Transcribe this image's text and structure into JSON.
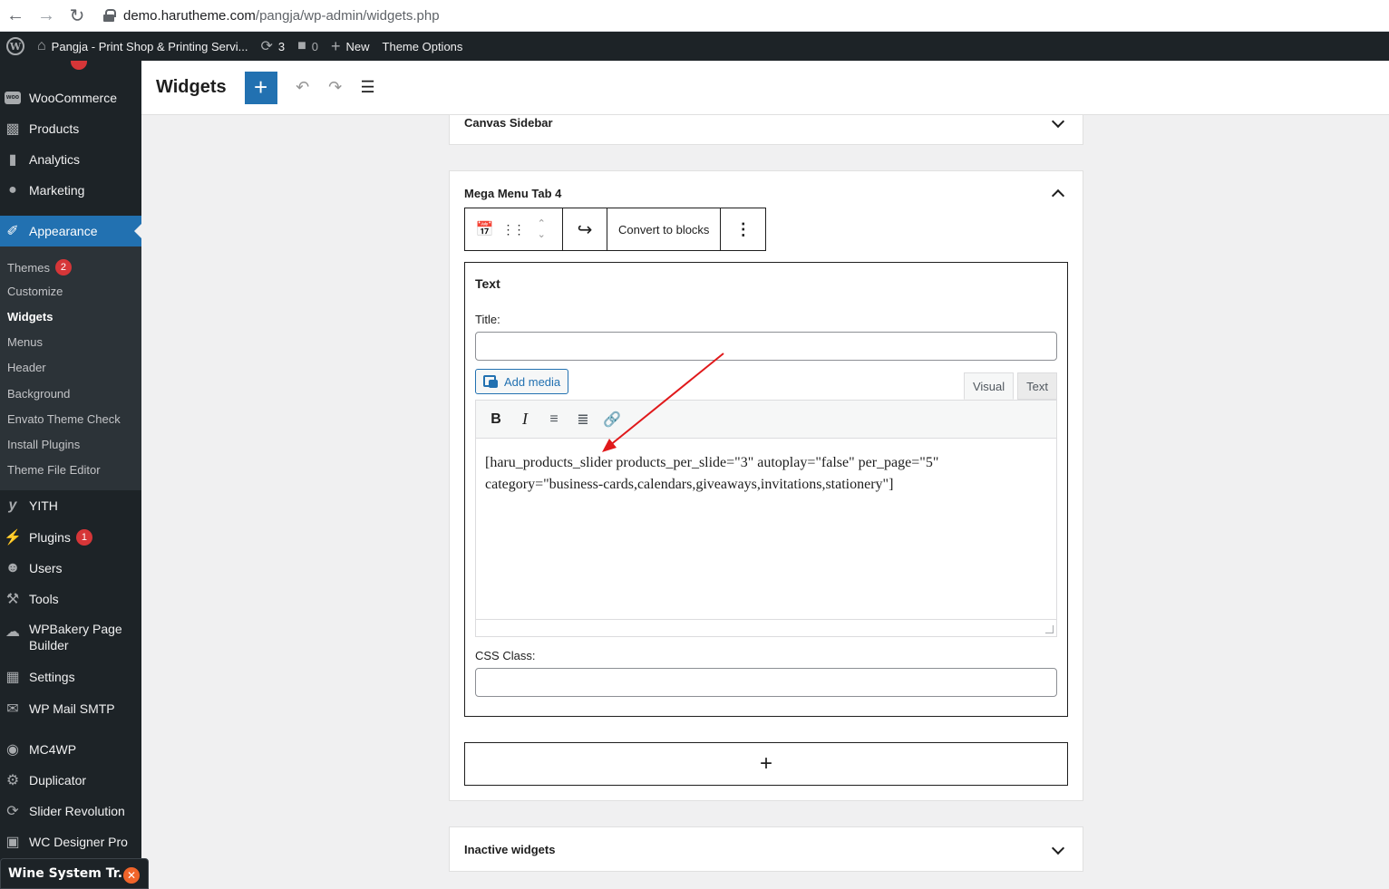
{
  "browser": {
    "url_host": "demo.harutheme.com",
    "url_path": "/pangja/wp-admin/widgets.php"
  },
  "adminbar": {
    "site_name": "Pangja - Print Shop & Printing Servi...",
    "updates_count": "3",
    "comments_count": "0",
    "new_label": "New",
    "theme_options_label": "Theme Options"
  },
  "sidebar": {
    "items": [
      {
        "label": "WooCommerce",
        "icon": "woocommerce-icon"
      },
      {
        "label": "Products",
        "icon": "products-icon"
      },
      {
        "label": "Analytics",
        "icon": "analytics-icon"
      },
      {
        "label": "Marketing",
        "icon": "marketing-icon"
      },
      {
        "label": "Appearance",
        "icon": "appearance-icon"
      },
      {
        "label": "YITH",
        "icon": "yith-icon"
      },
      {
        "label": "Plugins",
        "icon": "plugins-icon",
        "badge": "1"
      },
      {
        "label": "Users",
        "icon": "users-icon"
      },
      {
        "label": "Tools",
        "icon": "tools-icon"
      },
      {
        "label": "WPBakery Page Builder",
        "icon": "wpbakery-icon"
      },
      {
        "label": "Settings",
        "icon": "settings-icon"
      },
      {
        "label": "WP Mail SMTP",
        "icon": "mail-icon"
      },
      {
        "label": "MC4WP",
        "icon": "mc4wp-icon"
      },
      {
        "label": "Duplicator",
        "icon": "duplicator-icon"
      },
      {
        "label": "Slider Revolution",
        "icon": "slider-icon"
      },
      {
        "label": "WC Designer Pro",
        "icon": "designer-icon"
      }
    ],
    "submenu": [
      {
        "label": "Themes",
        "badge": "2"
      },
      {
        "label": "Customize"
      },
      {
        "label": "Widgets"
      },
      {
        "label": "Menus"
      },
      {
        "label": "Header"
      },
      {
        "label": "Background"
      },
      {
        "label": "Envato Theme Check"
      },
      {
        "label": "Install Plugins"
      },
      {
        "label": "Theme File Editor"
      }
    ],
    "toast_label": "Wine System Tr..."
  },
  "header": {
    "title": "Widgets"
  },
  "areas": {
    "canvas_sidebar": "Canvas Sidebar",
    "mega_menu": "Mega Menu Tab 4",
    "inactive": "Inactive widgets"
  },
  "toolbar": {
    "convert_label": "Convert to blocks"
  },
  "widget": {
    "heading": "Text",
    "title_label": "Title:",
    "title_value": "",
    "add_media_label": "Add media",
    "tab_visual": "Visual",
    "tab_text": "Text",
    "content_line1": "[haru_products_slider products_per_slide=\"3\" autoplay=\"false\" per_page=\"5\"",
    "content_line2": "category=\"business-cards,calendars,giveaways,invitations,stationery\"]",
    "css_label": "CSS Class:",
    "css_value": ""
  },
  "colors": {
    "accent": "#2271b1",
    "admin_bg": "#1d2327",
    "badge": "#d63638",
    "annotation_arrow": "#e0191b"
  }
}
